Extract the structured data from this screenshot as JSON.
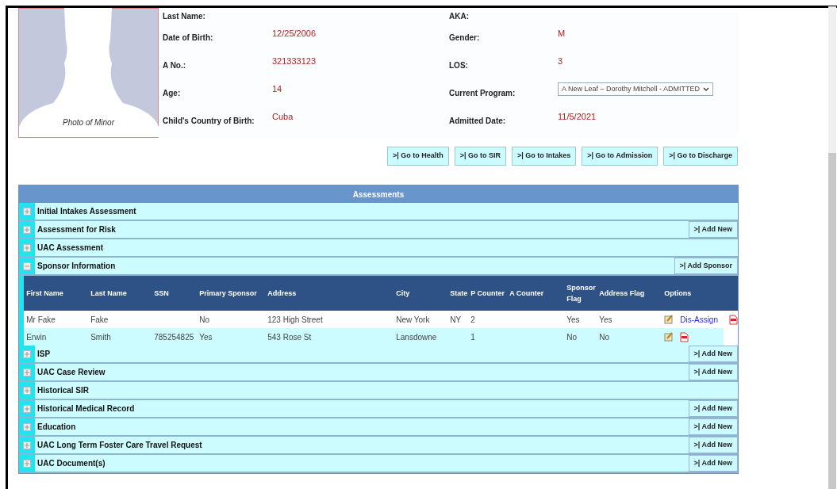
{
  "photo": {
    "caption": "Photo of Minor"
  },
  "fields_left": [
    {
      "label": "Last Name:"
    },
    {
      "label": "Date of Birth:",
      "value": "12/25/2006"
    },
    {
      "label": "A No.:",
      "value": "321333123"
    },
    {
      "label": "Age:",
      "value": "14"
    },
    {
      "label": "Child's Country of Birth:",
      "value": "Cuba"
    }
  ],
  "fields_right": [
    {
      "label": "AKA:",
      "kind": "text"
    },
    {
      "label": "Gender:",
      "kind": "text",
      "value": "M"
    },
    {
      "label": "LOS:",
      "kind": "text",
      "value": "3"
    },
    {
      "label": "Current Program:",
      "kind": "select",
      "value": "A New Leaf – Dorothy Mitchell - ADMITTED"
    },
    {
      "label": "Admitted Date:",
      "kind": "text",
      "value": "11/5/2021"
    }
  ],
  "nav_buttons": [
    ">| Go to Health",
    ">| Go to SIR",
    ">| Go to Intakes",
    ">| Go to Admission",
    ">| Go to Discharge"
  ],
  "assessments": {
    "title": "Assessments",
    "sections": [
      {
        "title": "Initial Intakes Assessment",
        "expanded": false
      },
      {
        "title": "Assessment for Risk",
        "expanded": false,
        "button": ">| Add New"
      },
      {
        "title": "UAC Assessment",
        "expanded": false
      },
      {
        "title": "Sponsor Information",
        "expanded": true,
        "button": ">| Add Sponsor",
        "table": {
          "columns": [
            "First Name",
            "Last Name",
            "SSN",
            "Primary Sponsor",
            "Address",
            "City",
            "State",
            "P Counter",
            "A Counter",
            "Sponsor Flag",
            "Address Flag",
            "Options"
          ],
          "rows": [
            {
              "cells": [
                "Mr Fake",
                "Fake",
                "",
                "No",
                "123 High Street",
                "New York",
                "NY",
                "2",
                "",
                "Yes",
                "Yes"
              ],
              "link": "Dis-Assign"
            },
            {
              "cells": [
                "Erwin",
                "Smith",
                "785254825",
                "Yes",
                "543 Rose St",
                "Lansdowne",
                "",
                "1",
                "",
                "No",
                "No"
              ]
            }
          ]
        }
      },
      {
        "title": "ISP",
        "expanded": false,
        "button": ">| Add New"
      },
      {
        "title": "UAC Case Review",
        "expanded": false,
        "button": ">| Add New"
      },
      {
        "title": "Historical SIR",
        "expanded": false
      },
      {
        "title": "Historical Medical Record",
        "expanded": false,
        "button": ">| Add New"
      },
      {
        "title": "Education",
        "expanded": false,
        "button": ">| Add New"
      },
      {
        "title": "UAC Long Term Foster Care Travel Request",
        "expanded": false,
        "button": ">| Add New"
      },
      {
        "title": "UAC Document(s)",
        "expanded": false,
        "button": ">| Add New"
      }
    ]
  }
}
